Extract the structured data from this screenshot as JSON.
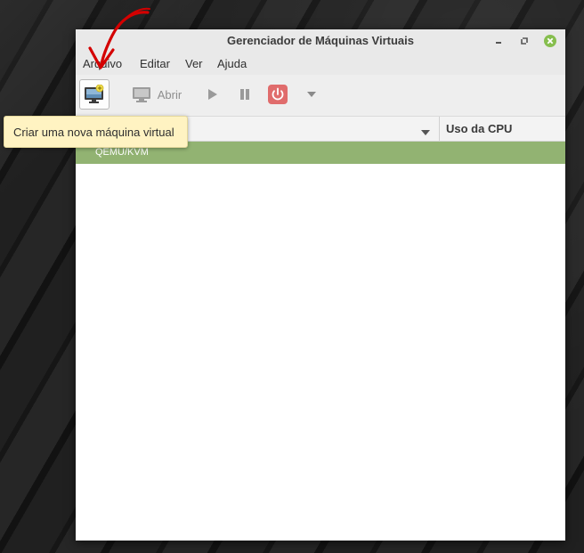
{
  "window": {
    "title": "Gerenciador de Máquinas Virtuais"
  },
  "menubar": {
    "items": [
      {
        "label": "Arquivo"
      },
      {
        "label": "Editar"
      },
      {
        "label": "Ver"
      },
      {
        "label": "Ajuda"
      }
    ]
  },
  "toolbar": {
    "new_vm_icon": "new-vm-icon",
    "open_label": "Abrir",
    "play_icon": "play-icon",
    "pause_icon": "pause-icon",
    "power_icon": "power-icon",
    "more_icon": "chevron-down-icon"
  },
  "columns": {
    "cpu_label": "Uso da CPU"
  },
  "list": {
    "connections": [
      {
        "label": "QEMU/KVM",
        "selected": true
      }
    ]
  },
  "tooltip": {
    "text": "Criar uma nova máquina virtual"
  },
  "colors": {
    "selection": "#92b372",
    "close_button": "#86be4e",
    "power_button": "#e06c6c",
    "tooltip_bg": "#fff3c2",
    "annotation_arrow": "#d40000"
  }
}
